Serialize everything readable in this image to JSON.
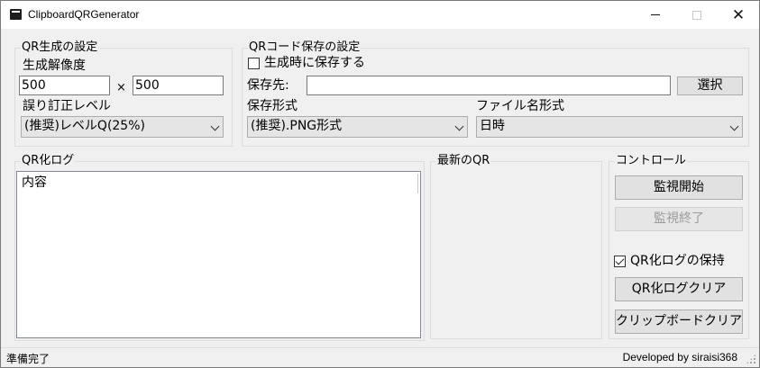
{
  "window": {
    "title": "ClipboardQRGenerator",
    "minimize_glyph": "—",
    "maximize_glyph": "□",
    "close_glyph": "✕"
  },
  "qr_settings": {
    "group_title": "QR生成の設定",
    "resolution_label": "生成解像度",
    "width_value": "500",
    "times_glyph": "×",
    "height_value": "500",
    "error_correction_label": "誤り訂正レベル",
    "error_correction_selected": "(推奨)レベルQ(25%)"
  },
  "save_settings": {
    "group_title": "QRコード保存の設定",
    "save_on_generate_label": "生成時に保存する",
    "save_on_generate_checked": false,
    "save_dest_label": "保存先:",
    "save_dest_value": "",
    "select_button": "選択",
    "save_format_label": "保存形式",
    "save_format_selected": "(推奨).PNG形式",
    "filename_format_label": "ファイル名形式",
    "filename_format_selected": "日時"
  },
  "qr_log": {
    "group_title": "QR化ログ",
    "header": "内容"
  },
  "latest_qr": {
    "group_title": "最新のQR"
  },
  "control": {
    "group_title": "コントロール",
    "start_button": "監視開始",
    "stop_button": "監視終了",
    "keep_log_label": "QR化ログの保持",
    "keep_log_checked": true,
    "clear_log_button": "QR化ログクリア",
    "clear_clipboard_button": "クリップボードクリア"
  },
  "status_bar": {
    "status": "準備完了",
    "developer": "Developed by siraisi368"
  }
}
